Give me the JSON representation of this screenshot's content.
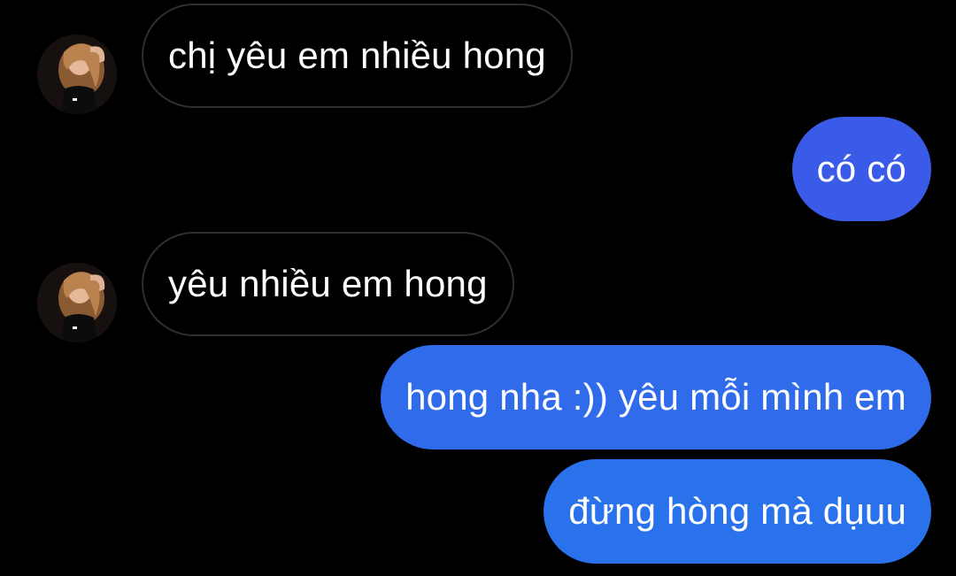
{
  "conversation": {
    "messages": [
      {
        "direction": "incoming",
        "text": "chị yêu em nhiều hong"
      },
      {
        "direction": "outgoing",
        "text": "có có"
      },
      {
        "direction": "incoming",
        "text": "yêu nhiều em hong"
      },
      {
        "direction": "outgoing",
        "text": "hong nha :)) yêu mỗi mình em"
      },
      {
        "direction": "outgoing",
        "text": "đừng hòng mà dụuu"
      }
    ]
  },
  "colors": {
    "background": "#000000",
    "incoming_border": "#2e2e2e",
    "outgoing_bubble_top": "#3a5be8",
    "outgoing_bubble_bottom": "#2a72ec",
    "text": "#ffffff"
  },
  "icons": {
    "contact_avatar": "avatar-photo"
  }
}
